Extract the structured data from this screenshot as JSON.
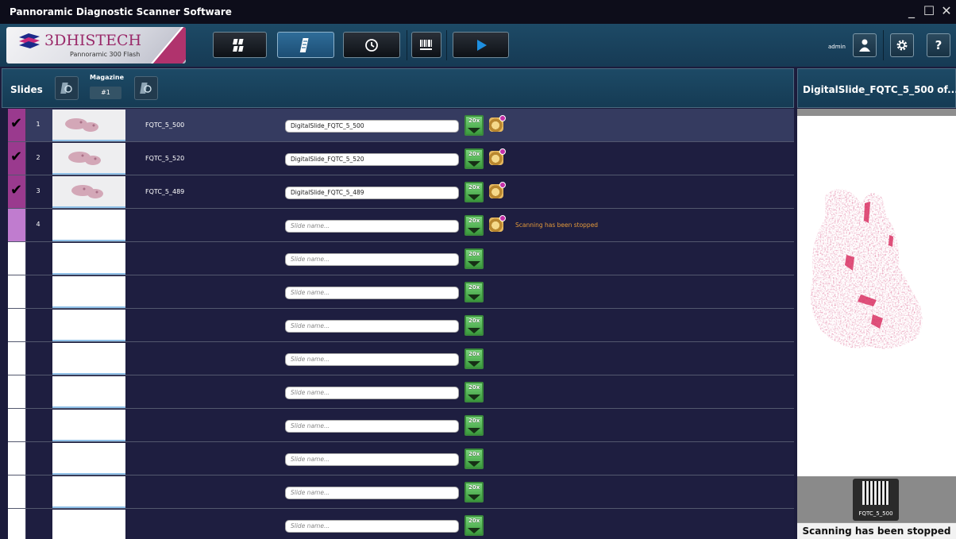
{
  "window": {
    "title": "Pannoramic Diagnostic Scanner Software",
    "controls": [
      "_",
      "☐",
      "✕"
    ]
  },
  "logo": {
    "brand": "3DHISTECH",
    "model": "Pannoramic 300 Flash"
  },
  "toolbar": {
    "buttons": [
      {
        "name": "slide-grid-view",
        "icon": "grid-slides-icon",
        "active": false
      },
      {
        "name": "single-slide-view",
        "icon": "slide-icon",
        "active": true
      },
      {
        "name": "history",
        "icon": "history-icon",
        "active": false
      },
      {
        "name": "barcode",
        "icon": "barcode-icon",
        "active": false
      },
      {
        "name": "start-scan",
        "icon": "play-icon",
        "active": false
      }
    ],
    "user": "admin",
    "accent": "#1e8fe0"
  },
  "slides_panel": {
    "title": "Slides",
    "magazine_label": "Magazine",
    "magazine_value": "#1"
  },
  "preview": {
    "title": "DigitalSlide_FQTC_5_500 of...",
    "label_text": "FQTC_5_500",
    "status": "Scanning has been stopped"
  },
  "colors": {
    "row_bg": "#1e1e40",
    "row_selected": "#353b60",
    "check_on": "#9a3a8e",
    "status_text": "#e49a3a"
  },
  "rows": [
    {
      "num": "1",
      "checked": true,
      "barcode": "FQTC_5_500",
      "slide_name": "DigitalSlide_FQTC_5_500",
      "placeholder": "",
      "focus": true,
      "status": "",
      "thumb": true,
      "selected": true
    },
    {
      "num": "2",
      "checked": true,
      "barcode": "FQTC_5_520",
      "slide_name": "DigitalSlide_FQTC_5_520",
      "placeholder": "",
      "focus": true,
      "status": "",
      "thumb": true,
      "selected": false
    },
    {
      "num": "3",
      "checked": true,
      "barcode": "FQTC_5_489",
      "slide_name": "DigitalSlide_FQTC_5_489",
      "placeholder": "",
      "focus": true,
      "status": "",
      "thumb": true,
      "selected": false
    },
    {
      "num": "4",
      "checked": "partial",
      "barcode": "",
      "slide_name": "",
      "placeholder": "Slide name...",
      "focus": true,
      "status": "Scanning has been stopped",
      "thumb": false,
      "selected": false
    },
    {
      "num": "",
      "checked": false,
      "barcode": "",
      "slide_name": "",
      "placeholder": "Slide name...",
      "focus": false,
      "status": "",
      "thumb": false,
      "selected": false
    },
    {
      "num": "",
      "checked": false,
      "barcode": "",
      "slide_name": "",
      "placeholder": "Slide name...",
      "focus": false,
      "status": "",
      "thumb": false,
      "selected": false
    },
    {
      "num": "",
      "checked": false,
      "barcode": "",
      "slide_name": "",
      "placeholder": "Slide name...",
      "focus": false,
      "status": "",
      "thumb": false,
      "selected": false
    },
    {
      "num": "",
      "checked": false,
      "barcode": "",
      "slide_name": "",
      "placeholder": "Slide name...",
      "focus": false,
      "status": "",
      "thumb": false,
      "selected": false
    },
    {
      "num": "",
      "checked": false,
      "barcode": "",
      "slide_name": "",
      "placeholder": "Slide name...",
      "focus": false,
      "status": "",
      "thumb": false,
      "selected": false
    },
    {
      "num": "",
      "checked": false,
      "barcode": "",
      "slide_name": "",
      "placeholder": "Slide name...",
      "focus": false,
      "status": "",
      "thumb": false,
      "selected": false
    },
    {
      "num": "",
      "checked": false,
      "barcode": "",
      "slide_name": "",
      "placeholder": "Slide name...",
      "focus": false,
      "status": "",
      "thumb": false,
      "selected": false
    },
    {
      "num": "",
      "checked": false,
      "barcode": "",
      "slide_name": "",
      "placeholder": "Slide name...",
      "focus": false,
      "status": "",
      "thumb": false,
      "selected": false
    },
    {
      "num": "",
      "checked": false,
      "barcode": "",
      "slide_name": "",
      "placeholder": "Slide name...",
      "focus": false,
      "status": "",
      "thumb": false,
      "selected": false
    }
  ],
  "objective_label": "20x"
}
